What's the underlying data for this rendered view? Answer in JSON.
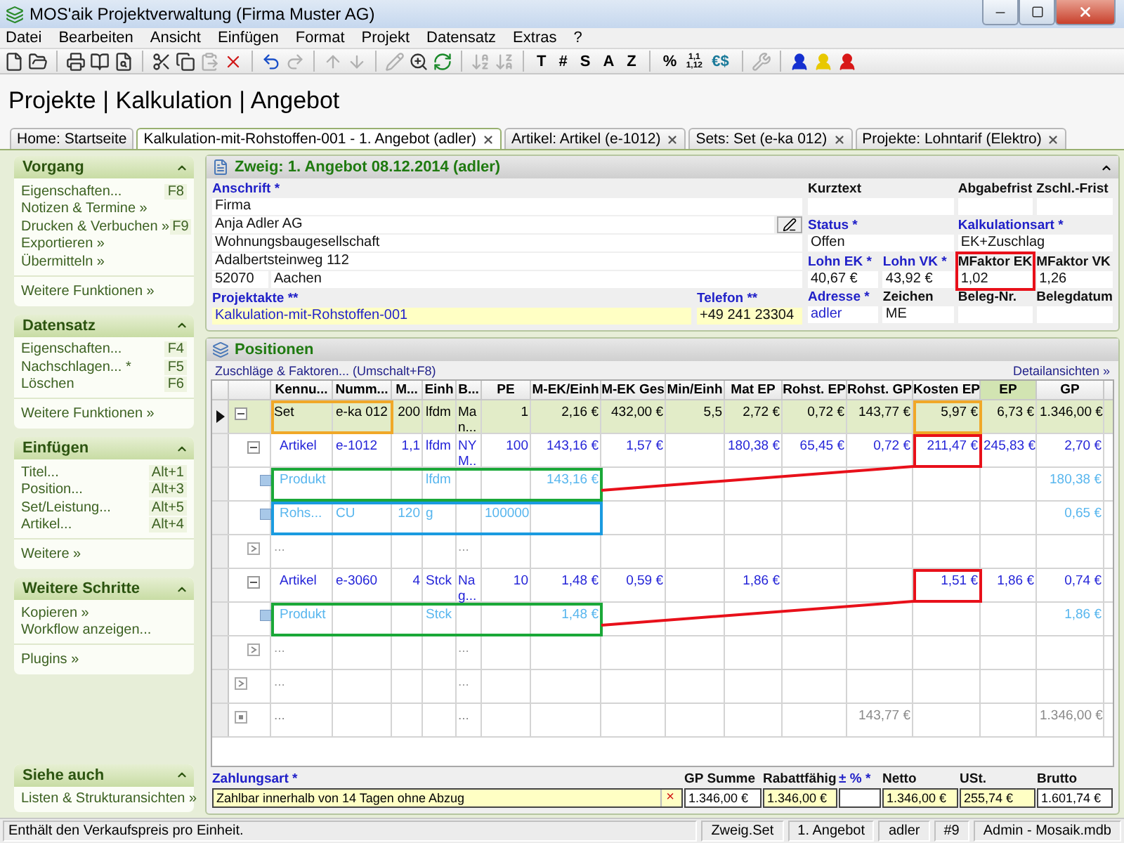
{
  "window": {
    "title": "MOS'aik Projektverwaltung (Firma Muster AG)"
  },
  "menu": [
    "Datei",
    "Bearbeiten",
    "Ansicht",
    "Einfügen",
    "Format",
    "Projekt",
    "Datensatz",
    "Extras",
    "?"
  ],
  "toolbar": [
    {
      "kind": "icon",
      "disabled": false
    },
    {
      "kind": "icon",
      "disabled": false
    },
    {
      "kind": "separator"
    },
    {
      "kind": "icon",
      "disabled": false
    },
    {
      "kind": "icon",
      "disabled": false
    },
    {
      "kind": "icon",
      "disabled": false
    },
    {
      "kind": "separator"
    },
    {
      "kind": "icon",
      "disabled": false
    },
    {
      "kind": "icon",
      "disabled": false
    },
    {
      "kind": "icon",
      "disabled": true
    },
    {
      "kind": "icon",
      "disabled": false
    },
    {
      "kind": "separator"
    },
    {
      "kind": "icon",
      "disabled": false
    },
    {
      "kind": "icon",
      "disabled": true
    },
    {
      "kind": "separator"
    },
    {
      "kind": "icon",
      "disabled": true
    },
    {
      "kind": "icon",
      "disabled": true
    },
    {
      "kind": "separator"
    },
    {
      "kind": "icon",
      "disabled": true
    },
    {
      "kind": "icon",
      "disabled": false
    },
    {
      "kind": "icon",
      "disabled": false
    },
    {
      "kind": "separator"
    },
    {
      "kind": "icon",
      "disabled": true
    },
    {
      "kind": "icon",
      "disabled": true
    },
    {
      "kind": "separator"
    },
    {
      "kind": "glyph",
      "label": "T"
    },
    {
      "kind": "glyph",
      "label": "#"
    },
    {
      "kind": "glyph",
      "label": "S"
    },
    {
      "kind": "glyph",
      "label": "A"
    },
    {
      "kind": "glyph",
      "label": "Z"
    },
    {
      "kind": "separator"
    },
    {
      "kind": "glyph",
      "label": "%"
    },
    {
      "kind": "small",
      "label": "1,1 1,12"
    },
    {
      "kind": "glyph",
      "label": "€$"
    },
    {
      "kind": "separator"
    },
    {
      "kind": "icon",
      "disabled": true
    },
    {
      "kind": "separator"
    },
    {
      "kind": "icon",
      "disabled": false,
      "color": "#1530d0"
    },
    {
      "kind": "icon",
      "disabled": false,
      "color": "#e8c800"
    },
    {
      "kind": "icon",
      "disabled": false,
      "color": "#d81818"
    }
  ],
  "heading": "Projekte | Kalkulation | Angebot",
  "tabs": [
    {
      "label": "Home: Startseite",
      "selected": false,
      "closable": false
    },
    {
      "label": "Kalkulation-mit-Rohstoffen-001 - 1. Angebot (adler)",
      "selected": true,
      "closable": true
    },
    {
      "label": "Artikel: Artikel (e-1012)",
      "selected": false,
      "closable": true
    },
    {
      "label": "Sets: Set (e-ka 012)",
      "selected": false,
      "closable": true
    },
    {
      "label": "Projekte: Lohntarif (Elektro)",
      "selected": false,
      "closable": true
    }
  ],
  "sidebar": [
    {
      "title": "Vorgang",
      "expanded": true,
      "items": [
        {
          "label": "Eigenschaften...",
          "shortcut": "F8"
        },
        {
          "label": "Notizen & Termine »"
        },
        {
          "label": "Drucken & Verbuchen »",
          "shortcut": "F9"
        },
        {
          "label": "Exportieren »"
        },
        {
          "label": "Übermitteln »"
        }
      ],
      "more": "Weitere Funktionen »"
    },
    {
      "title": "Datensatz",
      "expanded": true,
      "items": [
        {
          "label": "Eigenschaften...",
          "shortcut": "F4"
        },
        {
          "label": "Nachschlagen... *",
          "shortcut": "F5"
        },
        {
          "label": "Löschen",
          "shortcut": "F6"
        }
      ],
      "more": "Weitere Funktionen »"
    },
    {
      "title": "Einfügen",
      "expanded": true,
      "items": [
        {
          "label": "Titel...",
          "shortcut": "Alt+1"
        },
        {
          "label": "Position...",
          "shortcut": "Alt+3"
        },
        {
          "label": "Set/Leistung...",
          "shortcut": "Alt+5"
        },
        {
          "label": "Artikel...",
          "shortcut": "Alt+4"
        }
      ],
      "more": "Weitere »"
    },
    {
      "title": "Weitere Schritte",
      "expanded": true,
      "items": [
        {
          "label": "Kopieren »"
        },
        {
          "label": "Workflow anzeigen..."
        }
      ],
      "more": "Plugins »"
    },
    {
      "title": "Siehe auch",
      "expanded": true,
      "items": [
        {
          "label": "Listen & Strukturansichten »"
        }
      ]
    }
  ],
  "branch": {
    "title": "Zweig: 1. Angebot 08.12.2014 (adler)",
    "expanded": true,
    "address": {
      "label": "Anschrift *",
      "required": true,
      "lines": [
        {
          "text": "Firma",
          "picker": false
        },
        {
          "text": "Anja Adler AG",
          "picker": true
        },
        {
          "text": "Wohnungsbaugesellschaft",
          "picker": false
        },
        {
          "text": "Adalbertsteinweg 112",
          "picker": false
        }
      ],
      "zip": "52070",
      "city": "Aachen"
    },
    "file": {
      "label": "Projektakte **",
      "value": "Kalkulation-mit-Rohstoffen-001",
      "required": true,
      "highlighted": true,
      "link": true
    },
    "phone": {
      "label": "Telefon **",
      "value": "+49 241 23304",
      "required": true,
      "highlighted": true,
      "link": false
    },
    "fields": [
      {
        "label": "Kurztext",
        "required": false,
        "wide": true
      },
      {
        "label": "Abgabefrist",
        "required": false,
        "wide": false
      },
      {
        "label": "Zschl.-Frist",
        "required": false,
        "wide": false
      },
      {
        "label": "Status *",
        "value": "Offen",
        "required": true,
        "wide": true,
        "link": false
      },
      {
        "label": "Kalkulationsart *",
        "value": "EK+Zuschlag",
        "required": true,
        "wide": true,
        "link": false
      },
      {
        "label": "Lohn EK *",
        "value": "40,67 €",
        "required": true,
        "wide": false,
        "link": false
      },
      {
        "label": "Lohn VK *",
        "value": "43,92 €",
        "required": true,
        "wide": false,
        "link": false
      },
      {
        "label": "MFaktor EK",
        "value": "1,02",
        "required": false,
        "wide": false,
        "link": false,
        "color": "#e8101a"
      },
      {
        "label": "MFaktor VK",
        "value": "1,26",
        "required": false,
        "wide": false,
        "link": false
      },
      {
        "label": "Adresse *",
        "value": "adler",
        "required": true,
        "wide": false,
        "link": true
      },
      {
        "label": "Zeichen",
        "value": "ME",
        "required": false,
        "wide": false,
        "link": false
      },
      {
        "label": "Beleg-Nr.",
        "required": false,
        "wide": false
      },
      {
        "label": "Belegdatum",
        "required": false,
        "wide": false
      }
    ]
  },
  "positions": {
    "title": "Positionen",
    "surcharge_link": "Zuschläge & Faktoren... (Umschalt+F8)",
    "details_link": "Detailansichten »",
    "columns": [
      {
        "label": "Kennu...",
        "highlighted": false
      },
      {
        "label": "Numm...",
        "highlighted": false
      },
      {
        "label": "M...",
        "highlighted": false
      },
      {
        "label": "Einh",
        "highlighted": false
      },
      {
        "label": "B...",
        "highlighted": false
      },
      {
        "label": "PE",
        "highlighted": false
      },
      {
        "label": "M-EK/Einh",
        "highlighted": false
      },
      {
        "label": "M-EK Ges",
        "highlighted": false
      },
      {
        "label": "Min/Einh",
        "highlighted": false
      },
      {
        "label": "Mat EP",
        "highlighted": false
      },
      {
        "label": "Rohst. EP",
        "highlighted": false
      },
      {
        "label": "Rohst. GP",
        "highlighted": false
      },
      {
        "label": "Kosten EP",
        "highlighted": false
      },
      {
        "label": "EP",
        "highlighted": true
      },
      {
        "label": "GP",
        "highlighted": false
      }
    ],
    "rows": [
      {
        "kind": "set",
        "selected": true,
        "expanded": true,
        "cells": [
          {
            "text": "Set",
            "color": "#f0a828"
          },
          {
            "text": "e-ka 012",
            "color": "#f0a828"
          },
          "200",
          "lfdm",
          "Man...",
          "1",
          "2,16 €",
          "432,00 €",
          "5,5",
          "2,72 €",
          "0,72 €",
          "143,77 €",
          {
            "text": "5,97 €",
            "color": "#f0a828"
          },
          "6,73 €",
          "1.346,00 €"
        ],
        "children": [
          {
            "kind": "artikel",
            "selected": false,
            "expanded": true,
            "cells": [
              "Artikel",
              "e-1012",
              "1,1",
              "lfdm",
              "NY M..",
              "100",
              "143,16 €",
              "1,57 €",
              null,
              "180,38 €",
              "65,45 €",
              "0,72 €",
              {
                "text": "211,47 €",
                "color": "#e8101a"
              },
              "245,83 €",
              "2,70 €"
            ],
            "children": [
              {
                "kind": "produkt",
                "selected": false,
                "connector": true,
                "cells": [
                  {
                    "text": "Produkt",
                    "color": "#1aa838"
                  },
                  {
                    "color": "#1aa838"
                  },
                  {
                    "color": "#1aa838"
                  },
                  {
                    "text": "lfdm",
                    "color": "#1aa838"
                  },
                  {
                    "color": "#1aa838"
                  },
                  {
                    "color": "#1aa838"
                  },
                  {
                    "text": "143,16 €",
                    "color": "#1aa838"
                  },
                  null,
                  null,
                  null,
                  null,
                  null,
                  null,
                  null,
                  "180,38 €"
                ]
              },
              {
                "kind": "rohstoff",
                "selected": false,
                "connector": false,
                "cells": [
                  {
                    "text": "Rohs...",
                    "color": "#1a9be0"
                  },
                  {
                    "text": "CU",
                    "color": "#1a9be0"
                  },
                  {
                    "text": "120",
                    "color": "#1a9be0"
                  },
                  {
                    "text": "g",
                    "color": "#1a9be0"
                  },
                  {
                    "color": "#1a9be0"
                  },
                  {
                    "text": "100000",
                    "color": "#1a9be0"
                  },
                  {
                    "color": "#1a9be0"
                  },
                  null,
                  null,
                  null,
                  null,
                  null,
                  null,
                  null,
                  "0,65 €"
                ]
              },
              {
                "kind": "placeholder",
                "selected": false,
                "cells": [
                  "...",
                  null,
                  null,
                  null,
                  "...",
                  null,
                  null,
                  null,
                  null,
                  null,
                  null,
                  null,
                  null,
                  null,
                  null
                ]
              }
            ]
          },
          {
            "kind": "artikel",
            "selected": false,
            "expanded": true,
            "cells": [
              "Artikel",
              "e-3060",
              "4",
              "Stck",
              "Nag...",
              "10",
              "1,48 €",
              "0,59 €",
              null,
              "1,86 €",
              null,
              null,
              {
                "text": "1,51 €",
                "color": "#e8101a"
              },
              "1,86 €",
              "0,74 €"
            ],
            "children": [
              {
                "kind": "produkt",
                "selected": false,
                "connector": true,
                "cells": [
                  {
                    "text": "Produkt",
                    "color": "#1aa838"
                  },
                  {
                    "color": "#1aa838"
                  },
                  {
                    "color": "#1aa838"
                  },
                  {
                    "text": "Stck",
                    "color": "#1aa838"
                  },
                  {
                    "color": "#1aa838"
                  },
                  {
                    "color": "#1aa838"
                  },
                  {
                    "text": "1,48 €",
                    "color": "#1aa838"
                  },
                  null,
                  null,
                  null,
                  null,
                  null,
                  null,
                  null,
                  "1,86 €"
                ]
              },
              {
                "kind": "placeholder",
                "selected": false,
                "cells": [
                  "...",
                  null,
                  null,
                  null,
                  "...",
                  null,
                  null,
                  null,
                  null,
                  null,
                  null,
                  null,
                  null,
                  null,
                  null
                ]
              }
            ]
          },
          {
            "kind": "placeholder",
            "selected": false,
            "cells": [
              "...",
              null,
              null,
              null,
              "...",
              null,
              null,
              null,
              null,
              null,
              null,
              null,
              null,
              null,
              null
            ]
          },
          {
            "kind": "total",
            "selected": false,
            "cells": [
              "...",
              null,
              null,
              null,
              "...",
              null,
              null,
              null,
              null,
              null,
              null,
              "143,77 €",
              null,
              null,
              "1.346,00 €"
            ]
          }
        ]
      }
    ],
    "payment": {
      "label": "Zahlungsart *",
      "required": true,
      "value": "Zahlbar innerhalb von 14 Tagen ohne Abzug",
      "clear": "×"
    },
    "totals": [
      {
        "label": "GP Summe",
        "value": "1.346,00 €",
        "required": false,
        "highlighted": false
      },
      {
        "label": "Rabattfähig",
        "value": "1.346,00 €",
        "required": false,
        "highlighted": true
      },
      {
        "label": "± % *",
        "required": true,
        "highlighted": false
      },
      {
        "label": "Netto",
        "value": "1.346,00 €",
        "required": false,
        "highlighted": true
      },
      {
        "label": "USt.",
        "value": "255,74 €",
        "required": false,
        "highlighted": true
      },
      {
        "label": "Brutto",
        "value": "1.601,74 €",
        "required": false,
        "highlighted": false
      }
    ]
  },
  "status_bar": {
    "message": "Enthält den Verkaufspreis pro Einheit.",
    "panes": [
      "Zweig.Set",
      "1. Angebot",
      "adler",
      "#9",
      "Admin - Mosaik.mdb"
    ]
  }
}
